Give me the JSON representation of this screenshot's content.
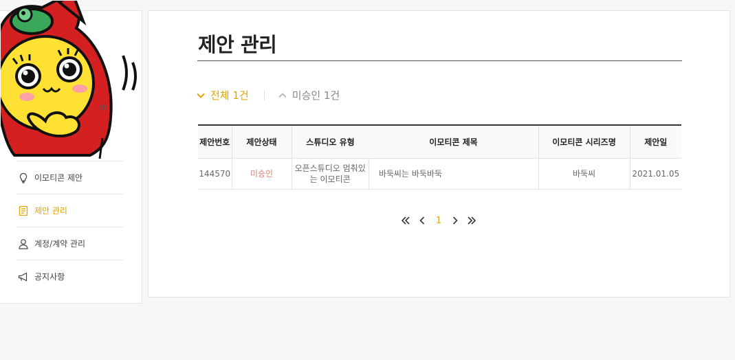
{
  "sidebar": {
    "email_partial": "m",
    "items": [
      {
        "label": "이모티콘 제안",
        "icon": "lightbulb-icon",
        "active": false
      },
      {
        "label": "제안 관리",
        "icon": "document-icon",
        "active": true
      },
      {
        "label": "계정/계약 관리",
        "icon": "person-icon",
        "active": false
      },
      {
        "label": "공지사항",
        "icon": "megaphone-icon",
        "active": false
      }
    ]
  },
  "main": {
    "title": "제안 관리",
    "filters": {
      "all_label": "전체 1건",
      "unapproved_label": "미승인 1건"
    },
    "table": {
      "headers": [
        "제안번호",
        "제안상태",
        "스튜디오 유형",
        "이모티콘 제목",
        "이모티콘 시리즈명",
        "제안일"
      ],
      "rows": [
        {
          "id": "144570",
          "status": "미승인",
          "studio_type": "오픈스튜디오 멈춰있는 이모티콘",
          "title": "바둑씨는 바둑바둑",
          "series": "바둑씨",
          "date": "2021.01.05"
        }
      ]
    },
    "pagination": {
      "current_page": "1"
    }
  },
  "colors": {
    "accent": "#e3a300",
    "status_unapproved": "#e87a6a"
  }
}
